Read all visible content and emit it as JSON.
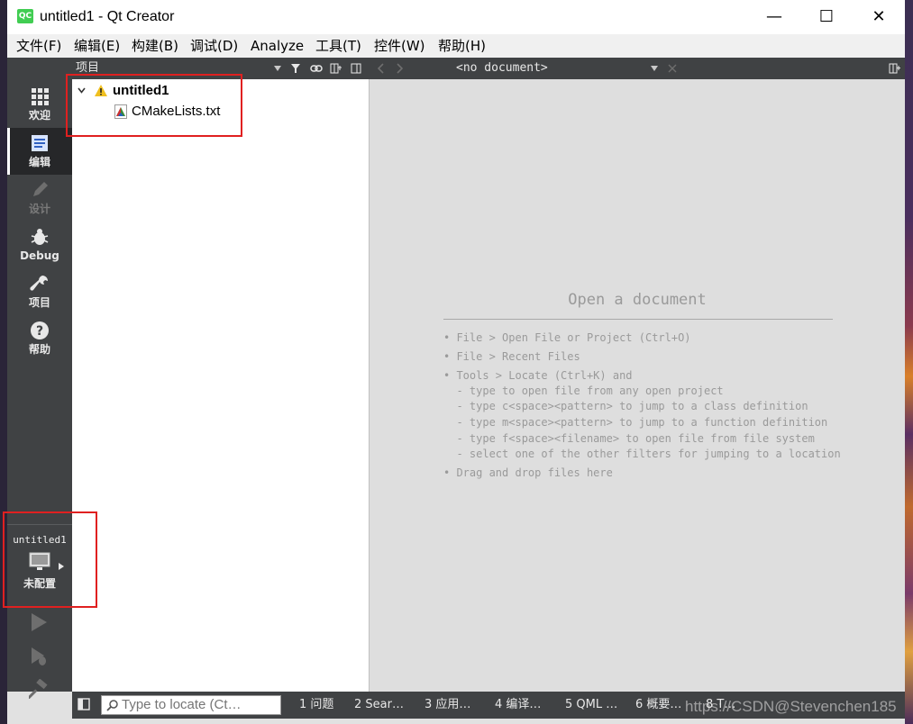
{
  "window": {
    "title": "untitled1 - Qt Creator",
    "logo_text": "QC",
    "minimize": "—",
    "maximize": "☐",
    "close": "✕"
  },
  "menu": [
    "文件(F)",
    "编辑(E)",
    "构建(B)",
    "调试(D)",
    "Analyze",
    "工具(T)",
    "控件(W)",
    "帮助(H)"
  ],
  "modes": [
    {
      "label": "欢迎",
      "icon": "grid-icon"
    },
    {
      "label": "编辑",
      "icon": "document-icon"
    },
    {
      "label": "设计",
      "icon": "pencil-icon"
    },
    {
      "label": "Debug",
      "icon": "bug-icon"
    },
    {
      "label": "项目",
      "icon": "wrench-icon"
    },
    {
      "label": "帮助",
      "icon": "help-icon"
    }
  ],
  "kit": {
    "project": "untitled1",
    "config": "未配置"
  },
  "project_panel": {
    "title": "项目",
    "root": "untitled1",
    "file": "CMakeLists.txt"
  },
  "editor": {
    "document_combo": "<no document>",
    "open_title": "Open a document",
    "hints": [
      "• File > Open File or Project (Ctrl+O)",
      "• File > Recent Files",
      "• Tools > Locate (Ctrl+K) and",
      "  - type to open file from any open project",
      "  - type c<space><pattern> to jump to a class definition",
      "  - type m<space><pattern> to jump to a function definition",
      "  - type f<space><filename> to open file from file system",
      "  - select one of the other filters for jumping to a location",
      "• Drag and drop files here"
    ]
  },
  "statusbar": {
    "locator_placeholder": "Type to locate (Ct…",
    "panes": [
      "1 问题",
      "2 Sear…",
      "3 应用…",
      "4 编译…",
      "5 QML …",
      "6 概要…",
      "8 T…"
    ]
  },
  "watermark": "https://CSDN@Stevenchen185",
  "colors": {
    "annotation": "#e02020",
    "modebar": "#404244",
    "qt_green": "#41cd52"
  }
}
